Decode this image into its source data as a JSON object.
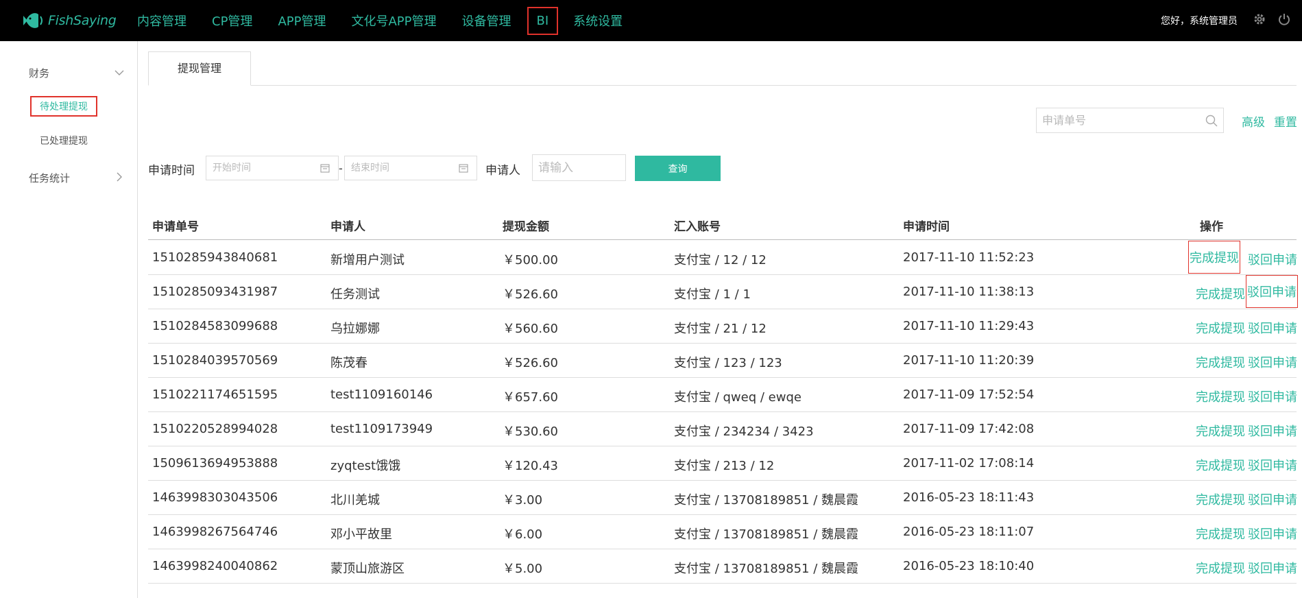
{
  "brand": {
    "name": "FishSaying"
  },
  "nav": {
    "items": [
      "内容管理",
      "CP管理",
      "APP管理",
      "文化号APP管理",
      "设备管理",
      "BI",
      "系统设置"
    ],
    "active": "BI"
  },
  "header": {
    "greeting": "您好，系统管理员"
  },
  "sidebar": {
    "groups": [
      {
        "label": "财务",
        "expanded": true,
        "children": [
          "待处理提现",
          "已处理提现"
        ]
      },
      {
        "label": "任务统计",
        "expanded": false,
        "children": []
      }
    ],
    "active_child": "待处理提现"
  },
  "tabs": {
    "active_label": "提现管理"
  },
  "search": {
    "placeholder": "申请单号",
    "advanced_label": "高级",
    "reset_label": "重置"
  },
  "filters": {
    "time_label": "申请时间",
    "start_placeholder": "开始时间",
    "range_sep": "-",
    "end_placeholder": "结束时间",
    "person_label": "申请人",
    "person_placeholder": "请输入",
    "query_label": "查询"
  },
  "table": {
    "headers": [
      "申请单号",
      "申请人",
      "提现金额",
      "汇入账号",
      "申请时间",
      "操作"
    ],
    "action_complete": "完成提现",
    "action_reject": "驳回申请",
    "rows": [
      [
        "1510285943840681",
        "新增用户测试",
        "￥500.00",
        "支付宝 / 12 / 12",
        "2017-11-10 11:52:23"
      ],
      [
        "1510285093431987",
        "任务测试",
        "￥526.60",
        "支付宝 / 1 / 1",
        "2017-11-10 11:38:13"
      ],
      [
        "1510284583099688",
        "乌拉娜娜",
        "￥560.60",
        "支付宝 / 21 / 12",
        "2017-11-10 11:29:43"
      ],
      [
        "1510284039570569",
        "陈茂春",
        "￥526.60",
        "支付宝 / 123 / 123",
        "2017-11-10 11:20:39"
      ],
      [
        "1510221174651595",
        "test1109160146",
        "￥657.60",
        "支付宝 / qweq / ewqe",
        "2017-11-09 17:52:54"
      ],
      [
        "1510220528994028",
        "test1109173949",
        "￥530.60",
        "支付宝 / 234234 / 3423",
        "2017-11-09 17:42:08"
      ],
      [
        "1509613694953888",
        "zyqtest饿饿",
        "￥120.43",
        "支付宝 / 213 / 12",
        "2017-11-02 17:08:14"
      ],
      [
        "1463998303043506",
        "北川羌城",
        "￥3.00",
        "支付宝 / 13708189851 / 魏晨霞",
        "2016-05-23 18:11:43"
      ],
      [
        "1463998267564746",
        "邓小平故里",
        "￥6.00",
        "支付宝 / 13708189851 / 魏晨霞",
        "2016-05-23 18:11:07"
      ],
      [
        "1463998240040862",
        "蒙顶山旅游区",
        "￥5.00",
        "支付宝 / 13708189851 / 魏晨霞",
        "2016-05-23 18:10:40"
      ]
    ]
  },
  "colors": {
    "accent": "#2fb9a0",
    "highlight": "#e0322b",
    "topbar": "#000000"
  }
}
